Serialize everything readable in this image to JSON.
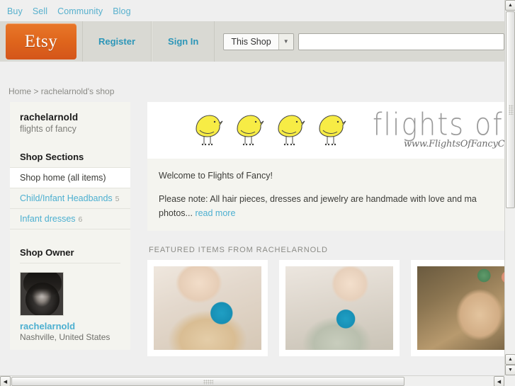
{
  "utility_nav": {
    "items": [
      {
        "label": "Buy"
      },
      {
        "label": "Sell"
      },
      {
        "label": "Community"
      },
      {
        "label": "Blog"
      }
    ]
  },
  "header": {
    "logo_text": "Etsy",
    "register_label": "Register",
    "signin_label": "Sign In",
    "search": {
      "scope_label": "This Shop",
      "caret_icon": "chevron-down-icon",
      "value": "",
      "placeholder": ""
    }
  },
  "breadcrumb": {
    "home_label": "Home",
    "separator": ">",
    "current_label": "rachelarnold's shop"
  },
  "sidebar": {
    "shop_name": "rachelarnold",
    "shop_tagline": "flights of fancy",
    "sections_heading": "Shop Sections",
    "sections": [
      {
        "label": "Shop home (all items)",
        "count": "",
        "active": true
      },
      {
        "label": "Child/Infant Headbands",
        "count": "5",
        "active": false
      },
      {
        "label": "Infant dresses",
        "count": "6",
        "active": false
      }
    ],
    "owner_heading": "Shop Owner",
    "owner_avatar_icon": "avatar",
    "owner_name": "rachelarnold",
    "owner_location": "Nashville, United States"
  },
  "main": {
    "banner": {
      "title": "flights of f",
      "url": "www.FlightsOfFancyCra",
      "bird_icon": "bird-icon",
      "bird_count": 4
    },
    "welcome": {
      "line1": "Welcome to Flights of Fancy!",
      "line2": "Please note: All hair pieces, dresses and jewelry are handmade with love and ma",
      "line3_prefix": "photos...",
      "read_more_label": "read more"
    },
    "featured_label": "FEATURED ITEMS FROM RACHELARNOLD",
    "featured_items": [
      {
        "photo_alt": "baby in cream floral dress with teal rosette"
      },
      {
        "photo_alt": "baby in blue floral romper with teal rosette"
      },
      {
        "photo_alt": "baby with green and peach flower headband"
      }
    ]
  },
  "scrollbars": {
    "v_up_icon": "triangle-up-icon",
    "v_down_icon": "triangle-down-icon",
    "h_left_icon": "triangle-left-icon",
    "h_right_icon": "triangle-right-icon"
  },
  "colors": {
    "etsy_orange": "#e0671d",
    "link_blue": "#4cafd0",
    "header_gray": "#d9d9d3",
    "panel_cream": "#f4f4ef",
    "page_gray": "#efefef",
    "rosette_teal": "#1f9fc4",
    "bird_yellow": "#f5e93f"
  }
}
